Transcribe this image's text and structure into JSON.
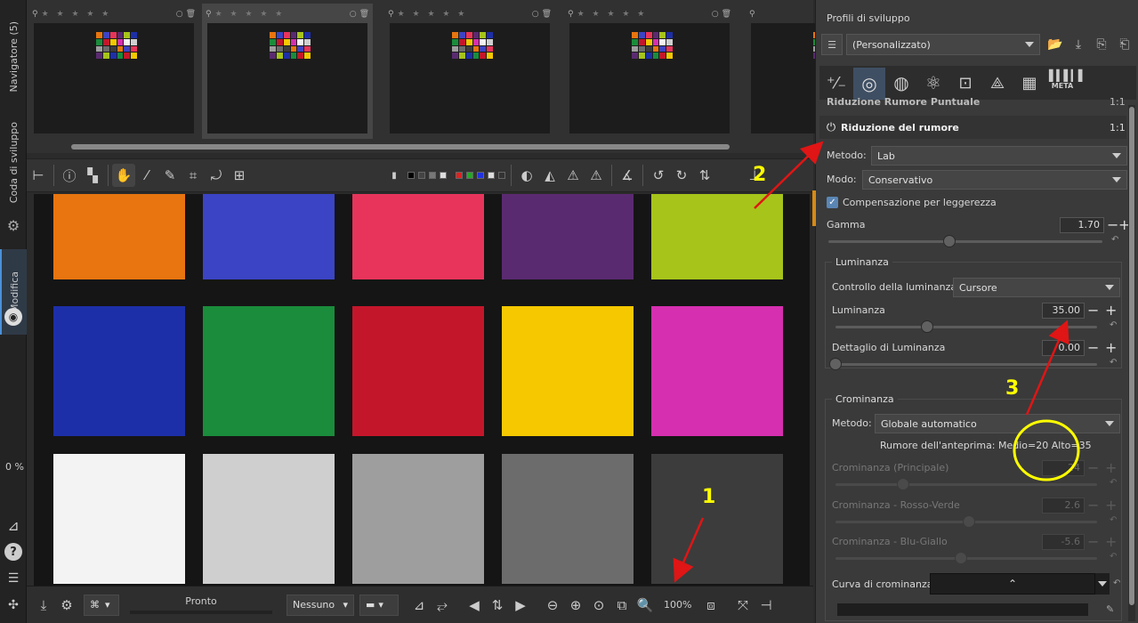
{
  "left_bar": {
    "tabs": [
      "Navigatore (5)",
      "Coda di sviluppo",
      "Modifica"
    ],
    "zoom_percent": "0 %"
  },
  "filmstrip": {
    "thumbnails": [
      {
        "selected": false,
        "stars": "★ ★ ★ ★ ★"
      },
      {
        "selected": true,
        "stars": "★ ★ ★ ★ ★"
      },
      {
        "selected": false,
        "stars": "★ ★ ★ ★ ★"
      },
      {
        "selected": false,
        "stars": "★ ★ ★ ★ ★"
      }
    ]
  },
  "status": {
    "ready": "Pronto",
    "zoom": "100%",
    "crop_mode": "Nessuno"
  },
  "colorchecker": {
    "rows": [
      [
        "#e8750f",
        "#3b44c4",
        "#e8345b",
        "#5a2a70",
        "#a6c41a"
      ],
      [
        "#1d2fa8",
        "#1a8c3b",
        "#c4162b",
        "#f5c800",
        "#d62fb0"
      ],
      [
        "#f3f3f3",
        "#cfcfcf",
        "#9e9e9e",
        "#6c6c6c",
        "#3c3c3c"
      ]
    ]
  },
  "right_panel": {
    "profiles_title": "Profili di sviluppo",
    "profile_value": "(Personalizzato)",
    "tabs": [
      "exposure",
      "detail",
      "color",
      "advanced",
      "transform",
      "raw",
      "locallab",
      "meta"
    ],
    "meta_label": "META",
    "prev_section": "Riduzione Rumore Puntuale",
    "prev_section_tag": "1:1",
    "section_title": "Riduzione del rumore",
    "section_tag": "1:1",
    "metodo_label": "Metodo:",
    "metodo_value": "Lab",
    "modo_label": "Modo:",
    "modo_value": "Conservativo",
    "compensation_label": "Compensazione per leggerezza",
    "gamma_label": "Gamma",
    "gamma_value": "1.70",
    "gamma_fraction": 0.44,
    "luminance": {
      "title": "Luminanza",
      "control_label": "Controllo della luminanza:",
      "control_value": "Cursore",
      "lum_label": "Luminanza",
      "lum_value": "35.00",
      "lum_fraction": 0.35,
      "detail_label": "Dettaglio di Luminanza",
      "detail_value": "0.00",
      "detail_fraction": 0.0
    },
    "chrominance": {
      "title": "Crominanza",
      "method_label": "Metodo:",
      "method_value": "Globale automatico",
      "preview_noise": "Rumore dell'anteprima: Medio=20 Alto=35",
      "main_label": "Crominanza (Principale)",
      "main_value": "24",
      "main_fraction": 0.26,
      "rg_label": "Crominanza - Rosso-Verde",
      "rg_value": "2.6",
      "rg_fraction": 0.51,
      "by_label": "Crominanza - Blu-Giallo",
      "by_value": "-5.6",
      "by_fraction": 0.48,
      "curve_label": "Curva di crominanza:"
    }
  },
  "annotations": {
    "n1": "1",
    "n2": "2",
    "n3": "3",
    "arrow_color": "#e01515",
    "number_color": "#ffff00",
    "circle_color": "#ffff00"
  }
}
